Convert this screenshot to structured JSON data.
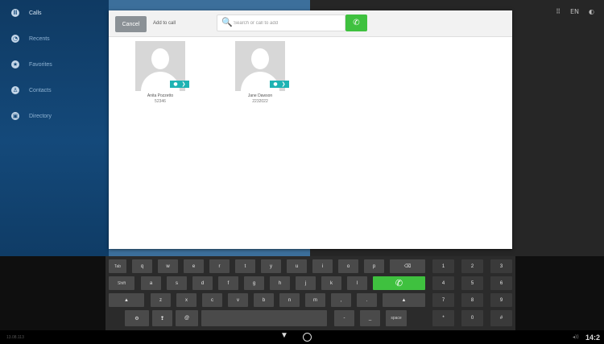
{
  "sidebar": {
    "items": [
      {
        "label": "Calls",
        "icon": "calls-icon",
        "glyph": "ll"
      },
      {
        "label": "Recents",
        "icon": "recents-icon",
        "glyph": "◔"
      },
      {
        "label": "Favorites",
        "icon": "star-icon",
        "glyph": "★"
      },
      {
        "label": "Contacts",
        "icon": "person-icon",
        "glyph": "♙"
      },
      {
        "label": "Directory",
        "icon": "directory-icon",
        "glyph": "▣"
      }
    ]
  },
  "topbar": {
    "grid_glyph": "⠿",
    "lang": "EN",
    "settings_glyph": "◐"
  },
  "dialog": {
    "cancel_label": "Cancel",
    "title": "Add to call",
    "search_placeholder": "Search or call to add",
    "search_glyph": "🔍",
    "call_glyph": "✆",
    "contacts": [
      {
        "name": "Anita Pozzetto",
        "number": "52346"
      },
      {
        "name": "Jane Dawson",
        "number": "2232022"
      }
    ],
    "badge_glyphs": [
      "●",
      "❯"
    ]
  },
  "keyboard": {
    "row1": [
      "Tab",
      "q",
      "w",
      "e",
      "r",
      "t",
      "y",
      "u",
      "i",
      "o",
      "p",
      "⌫"
    ],
    "row2": [
      "Shift",
      "a",
      "s",
      "d",
      "f",
      "g",
      "h",
      "j",
      "k",
      "l"
    ],
    "row3": [
      "▲",
      "z",
      "x",
      "c",
      "v",
      "b",
      "n",
      "m",
      ",",
      ".",
      "▲"
    ],
    "row4": [
      "⚙",
      "❢",
      "@",
      "",
      "-",
      "_",
      "space"
    ],
    "call_glyph": "✆",
    "numpad": [
      "1",
      "2",
      "3",
      "4",
      "5",
      "6",
      "7",
      "8",
      "9",
      "*",
      "0",
      "#"
    ]
  },
  "navbar": {
    "build": "13.08.113",
    "down_glyph": "▼",
    "volume": "◂))",
    "time": "14:2"
  }
}
